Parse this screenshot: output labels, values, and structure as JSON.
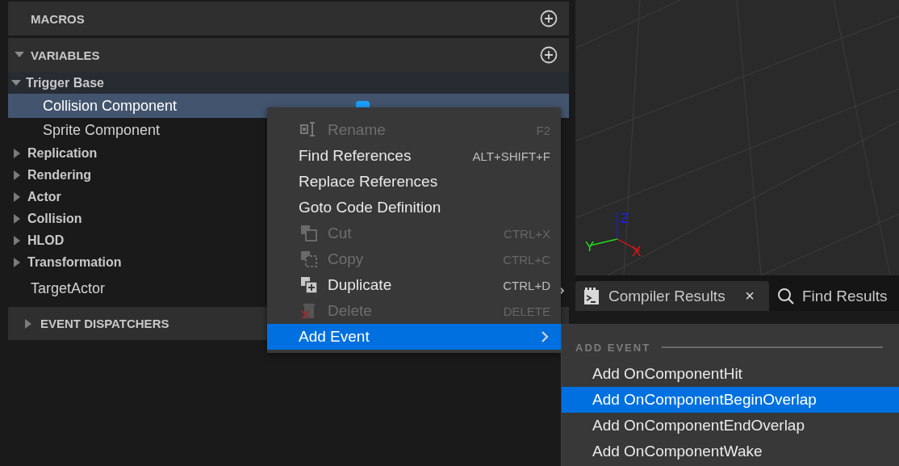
{
  "macros": {
    "title": "MACROS"
  },
  "variables": {
    "title": "VARIABLES",
    "expanded": true,
    "categories": [
      {
        "name": "Trigger Base",
        "expanded": true,
        "children": [
          {
            "name": "Collision Component",
            "selected": true
          },
          {
            "name": "Sprite Component",
            "selected": false
          }
        ]
      },
      {
        "name": "Replication",
        "expanded": false
      },
      {
        "name": "Rendering",
        "expanded": false
      },
      {
        "name": "Actor",
        "expanded": false
      },
      {
        "name": "Collision",
        "expanded": false
      },
      {
        "name": "HLOD",
        "expanded": false
      },
      {
        "name": "Transformation",
        "expanded": false
      }
    ],
    "items": [
      {
        "name": "TargetActor"
      }
    ]
  },
  "event_dispatchers": {
    "title": "EVENT DISPATCHERS",
    "expanded": false
  },
  "viewport": {
    "axes": [
      {
        "label": "Z",
        "color": "#1a1aff"
      },
      {
        "label": "Y",
        "color": "#22dd22"
      },
      {
        "label": "X",
        "color": "#ee1111"
      }
    ]
  },
  "tabs": [
    {
      "label": "Compiler Results",
      "selected": true,
      "close": "×",
      "kind": "terminal"
    },
    {
      "label": "Find Results",
      "selected": false,
      "kind": "search"
    }
  ],
  "context_menu": {
    "items": [
      {
        "label": "Rename",
        "shortcut": "F2",
        "kind": "rename",
        "disabled": true,
        "selected": false
      },
      {
        "label": "Find References",
        "shortcut": "ALT+SHIFT+F",
        "disabled": false,
        "selected": false
      },
      {
        "label": "Replace References",
        "disabled": false,
        "selected": false
      },
      {
        "label": "Goto Code Definition",
        "disabled": false,
        "selected": false
      },
      {
        "label": "Cut",
        "shortcut": "CTRL+X",
        "kind": "cut",
        "disabled": true,
        "selected": false
      },
      {
        "label": "Copy",
        "shortcut": "CTRL+C",
        "kind": "copy",
        "disabled": true,
        "selected": false
      },
      {
        "label": "Duplicate",
        "shortcut": "CTRL+D",
        "kind": "duplicate",
        "disabled": false,
        "selected": false
      },
      {
        "label": "Delete",
        "shortcut": "DELETE",
        "kind": "delete",
        "disabled": true,
        "selected": false
      },
      {
        "label": "Add Event",
        "submenu": true,
        "disabled": false,
        "selected": true
      }
    ]
  },
  "submenu": {
    "title": "ADD EVENT",
    "items": [
      {
        "label": "Add OnComponentHit",
        "selected": false
      },
      {
        "label": "Add OnComponentBeginOverlap",
        "selected": true
      },
      {
        "label": "Add OnComponentEndOverlap",
        "selected": false
      },
      {
        "label": "Add OnComponentWake",
        "selected": false
      }
    ]
  }
}
